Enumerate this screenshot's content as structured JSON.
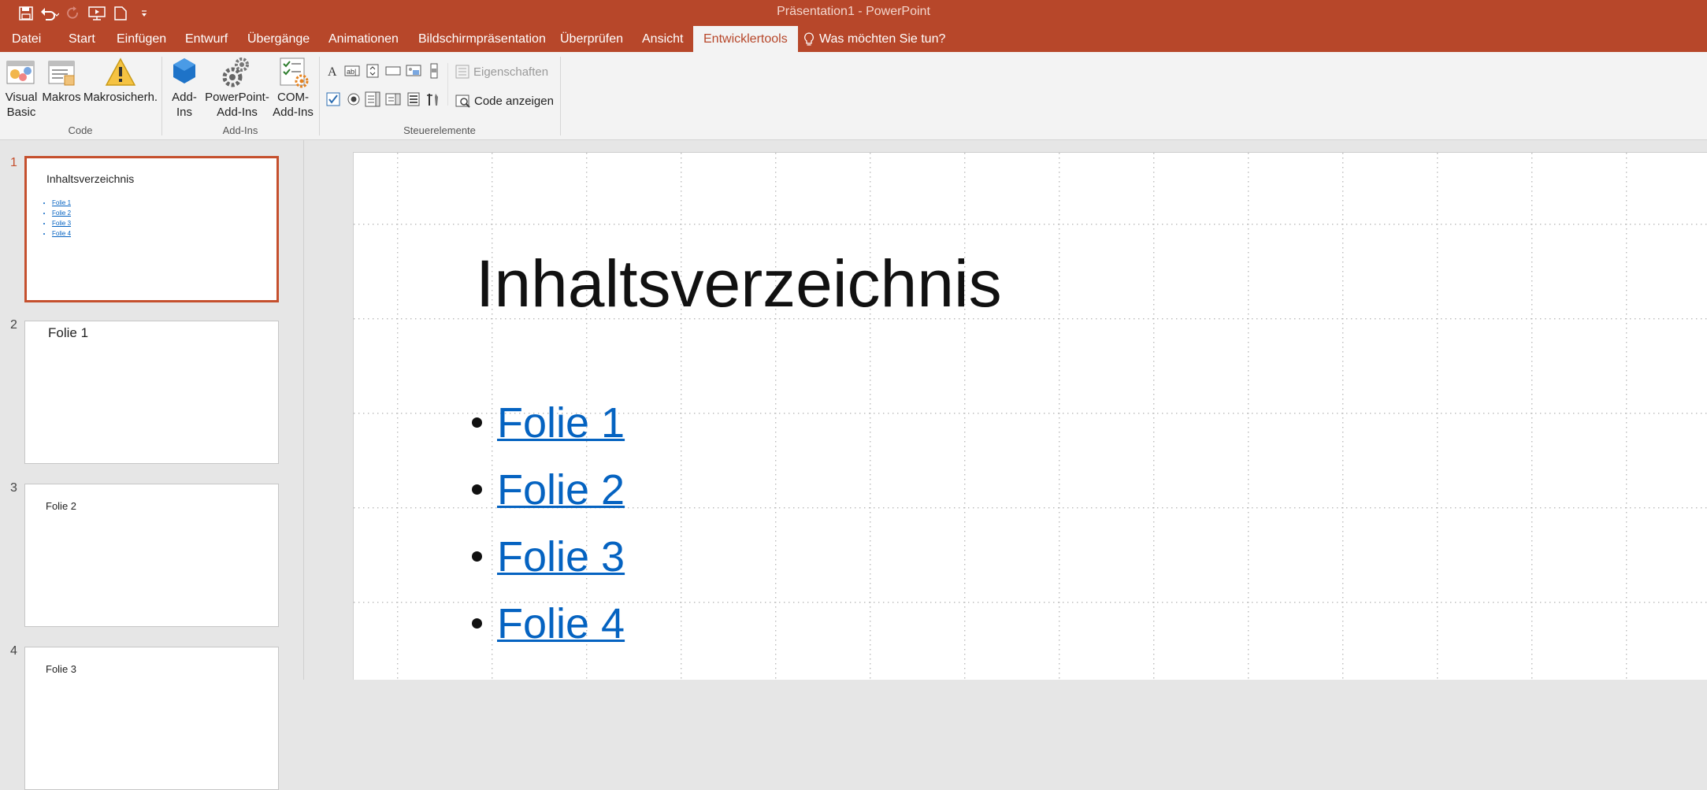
{
  "window": {
    "title": "Präsentation1 - PowerPoint"
  },
  "qat": {
    "items": [
      {
        "icon": "save-icon",
        "label": "Speichern"
      },
      {
        "icon": "undo-icon",
        "label": "Rückgängig"
      },
      {
        "icon": "redo-icon",
        "label": "Wiederholen"
      },
      {
        "icon": "present-icon",
        "label": "Von Anfang an"
      },
      {
        "icon": "new-doc-icon",
        "label": "Neu"
      },
      {
        "icon": "customize-icon",
        "label": "Anpassen"
      }
    ]
  },
  "tabs": {
    "file": "Datei",
    "items": [
      "Start",
      "Einfügen",
      "Entwurf",
      "Übergänge",
      "Animationen",
      "Bildschirmpräsentation",
      "Überprüfen",
      "Ansicht",
      "Entwicklertools"
    ],
    "active": "Entwicklertools",
    "tell_me": "Was möchten Sie tun?"
  },
  "ribbon": {
    "groups": {
      "code": {
        "label": "Code",
        "visual_basic": "Visual\nBasic",
        "macros": "Makros",
        "macro_security": "Makrosicherh."
      },
      "addins": {
        "label": "Add-Ins",
        "addins": "Add-\nIns",
        "ppt_addins": "PowerPoint-\nAdd-Ins",
        "com_addins": "COM-\nAdd-Ins"
      },
      "controls": {
        "label": "Steuerelemente",
        "properties": "Eigenschaften",
        "view_code": "Code anzeigen"
      }
    }
  },
  "thumbnails": [
    {
      "number": "1",
      "title": "Inhaltsverzeichnis",
      "links": [
        "Folie 1",
        "Folie 2",
        "Folie 3",
        "Folie 4"
      ]
    },
    {
      "number": "2",
      "title": "Folie 1"
    },
    {
      "number": "3",
      "title": "Folie 2"
    },
    {
      "number": "4",
      "title": "Folie 3"
    }
  ],
  "slide": {
    "title": "Inhaltsverzeichnis",
    "links": [
      "Folie 1",
      "Folie 2",
      "Folie 3",
      "Folie 4"
    ]
  },
  "colors": {
    "accent": "#b7472a",
    "link": "#0563c1",
    "selection": "#c5502e"
  }
}
